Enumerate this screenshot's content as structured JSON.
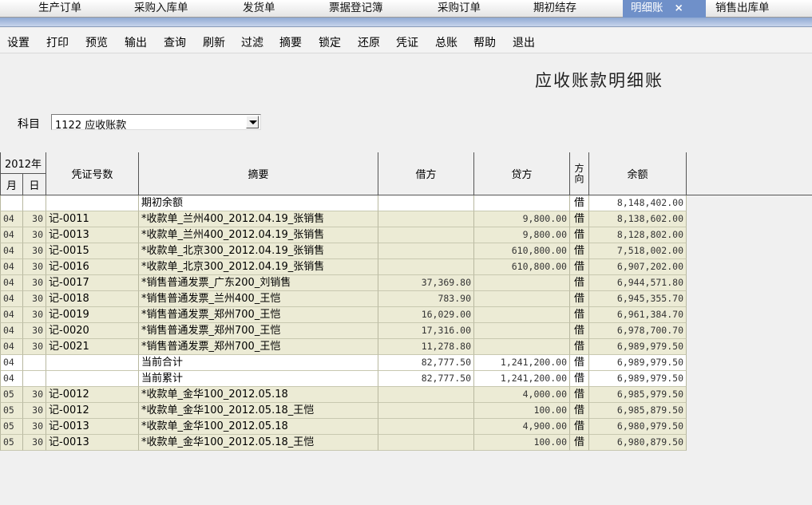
{
  "tabs": [
    {
      "label": "生产订单",
      "active": false
    },
    {
      "label": "采购入库单",
      "active": false
    },
    {
      "label": "发货单",
      "active": false
    },
    {
      "label": "票据登记簿",
      "active": false
    },
    {
      "label": "采购订单",
      "active": false
    },
    {
      "label": "期初结存",
      "active": false
    },
    {
      "label": "明细账",
      "active": true,
      "close": "×"
    },
    {
      "label": "销售出库单",
      "active": false
    }
  ],
  "toolbar": [
    "设置",
    "打印",
    "预览",
    "输出",
    "查询",
    "刷新",
    "过滤",
    "摘要",
    "锁定",
    "还原",
    "凭证",
    "总账",
    "帮助",
    "退出"
  ],
  "report": {
    "title": "应收账款明细账",
    "subject_label": "科目",
    "subject_value": "1122 应收账款"
  },
  "table": {
    "headers": {
      "year": "2012年",
      "month": "月",
      "day": "日",
      "voucher": "凭证号数",
      "summary": "摘要",
      "debit": "借方",
      "credit": "贷方",
      "direction": "方向",
      "balance": "余额"
    },
    "rows": [
      {
        "month": "",
        "day": "",
        "voucher": "",
        "summary": "期初余额",
        "debit": "",
        "credit": "",
        "dir": "借",
        "balance": "8,148,402.00",
        "kind": "plain"
      },
      {
        "month": "04",
        "day": "30",
        "voucher": "记-0011",
        "summary": "*收款单_兰州400_2012.04.19_张销售",
        "debit": "",
        "credit": "9,800.00",
        "dir": "借",
        "balance": "8,138,602.00",
        "kind": "tinted"
      },
      {
        "month": "04",
        "day": "30",
        "voucher": "记-0013",
        "summary": "*收款单_兰州400_2012.04.19_张销售",
        "debit": "",
        "credit": "9,800.00",
        "dir": "借",
        "balance": "8,128,802.00",
        "kind": "tinted"
      },
      {
        "month": "04",
        "day": "30",
        "voucher": "记-0015",
        "summary": "*收款单_北京300_2012.04.19_张销售",
        "debit": "",
        "credit": "610,800.00",
        "dir": "借",
        "balance": "7,518,002.00",
        "kind": "tinted"
      },
      {
        "month": "04",
        "day": "30",
        "voucher": "记-0016",
        "summary": "*收款单_北京300_2012.04.19_张销售",
        "debit": "",
        "credit": "610,800.00",
        "dir": "借",
        "balance": "6,907,202.00",
        "kind": "tinted"
      },
      {
        "month": "04",
        "day": "30",
        "voucher": "记-0017",
        "summary": "*销售普通发票_广东200_刘销售",
        "debit": "37,369.80",
        "credit": "",
        "dir": "借",
        "balance": "6,944,571.80",
        "kind": "tinted"
      },
      {
        "month": "04",
        "day": "30",
        "voucher": "记-0018",
        "summary": "*销售普通发票_兰州400_王恺",
        "debit": "783.90",
        "credit": "",
        "dir": "借",
        "balance": "6,945,355.70",
        "kind": "tinted"
      },
      {
        "month": "04",
        "day": "30",
        "voucher": "记-0019",
        "summary": "*销售普通发票_郑州700_王恺",
        "debit": "16,029.00",
        "credit": "",
        "dir": "借",
        "balance": "6,961,384.70",
        "kind": "tinted"
      },
      {
        "month": "04",
        "day": "30",
        "voucher": "记-0020",
        "summary": "*销售普通发票_郑州700_王恺",
        "debit": "17,316.00",
        "credit": "",
        "dir": "借",
        "balance": "6,978,700.70",
        "kind": "tinted"
      },
      {
        "month": "04",
        "day": "30",
        "voucher": "记-0021",
        "summary": "*销售普通发票_郑州700_王恺",
        "debit": "11,278.80",
        "credit": "",
        "dir": "借",
        "balance": "6,989,979.50",
        "kind": "tinted"
      },
      {
        "month": "04",
        "day": "",
        "voucher": "",
        "summary": "当前合计",
        "debit": "82,777.50",
        "credit": "1,241,200.00",
        "dir": "借",
        "balance": "6,989,979.50",
        "kind": "plain"
      },
      {
        "month": "04",
        "day": "",
        "voucher": "",
        "summary": "当前累计",
        "debit": "82,777.50",
        "credit": "1,241,200.00",
        "dir": "借",
        "balance": "6,989,979.50",
        "kind": "plain"
      },
      {
        "month": "05",
        "day": "30",
        "voucher": "记-0012",
        "summary": "*收款单_金华100_2012.05.18",
        "debit": "",
        "credit": "4,000.00",
        "dir": "借",
        "balance": "6,985,979.50",
        "kind": "tinted"
      },
      {
        "month": "05",
        "day": "30",
        "voucher": "记-0012",
        "summary": "*收款单_金华100_2012.05.18_王恺",
        "debit": "",
        "credit": "100.00",
        "dir": "借",
        "balance": "6,985,879.50",
        "kind": "tinted"
      },
      {
        "month": "05",
        "day": "30",
        "voucher": "记-0013",
        "summary": "*收款单_金华100_2012.05.18",
        "debit": "",
        "credit": "4,900.00",
        "dir": "借",
        "balance": "6,980,979.50",
        "kind": "tinted"
      },
      {
        "month": "05",
        "day": "30",
        "voucher": "记-0013",
        "summary": "*收款单_金华100_2012.05.18_王恺",
        "debit": "",
        "credit": "100.00",
        "dir": "借",
        "balance": "6,980,879.50",
        "kind": "tinted"
      }
    ]
  }
}
